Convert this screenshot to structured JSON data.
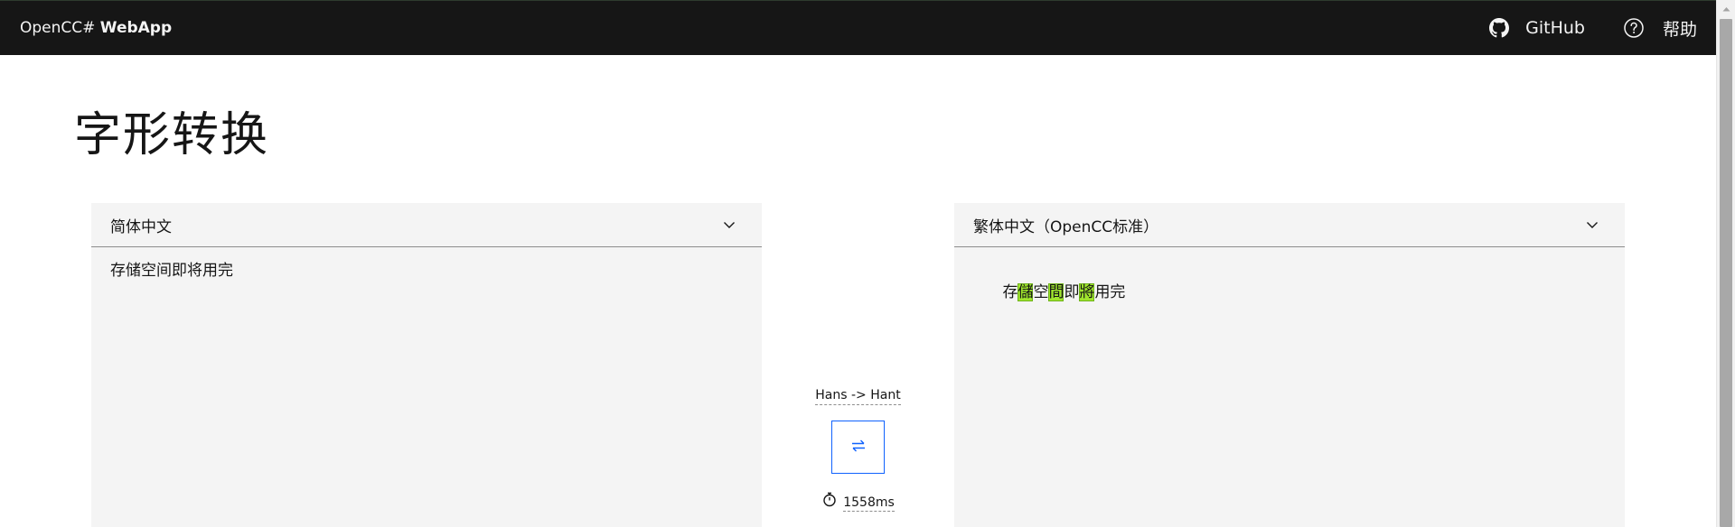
{
  "header": {
    "brand_prefix": "OpenCC#",
    "brand_bold": "WebApp",
    "github_label": "GitHub",
    "help_label": "帮助"
  },
  "page": {
    "title": "字形转换"
  },
  "source": {
    "language": "简体中文",
    "text": "存储空间即将用完"
  },
  "target": {
    "language": "繁体中文（OpenCC标准）",
    "segments": [
      {
        "text": "存",
        "changed": false
      },
      {
        "text": "儲",
        "changed": true
      },
      {
        "text": "空",
        "changed": false
      },
      {
        "text": "間",
        "changed": true
      },
      {
        "text": "即",
        "changed": false
      },
      {
        "text": "將",
        "changed": true
      },
      {
        "text": "用完",
        "changed": false
      }
    ]
  },
  "converter": {
    "mode": "Hans -> Hant",
    "swap_icon": "swap-arrows-icon",
    "timer_icon": "stopwatch-icon",
    "elapsed": "1558ms"
  },
  "colors": {
    "header_bg": "#161616",
    "panel_bg": "#f4f4f4",
    "accent": "#0f62fe",
    "highlight": "#9fe52d"
  }
}
